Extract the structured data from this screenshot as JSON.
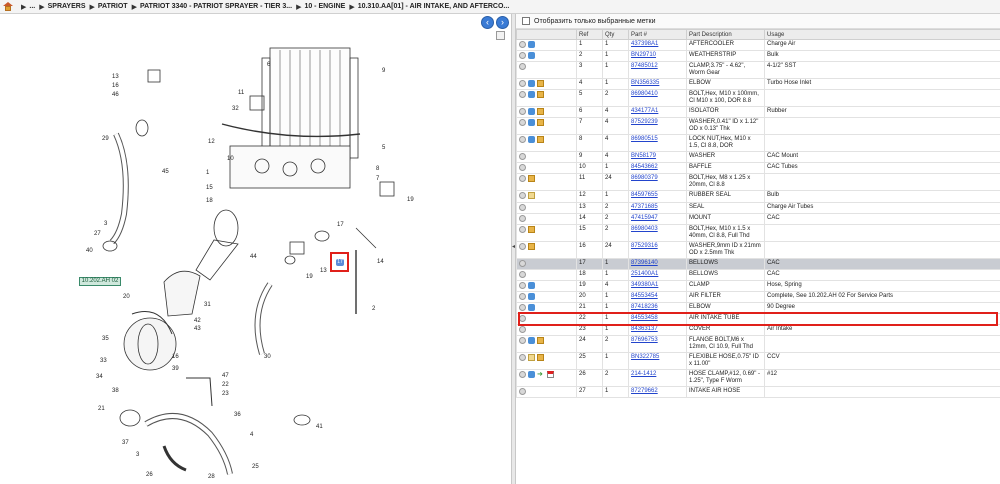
{
  "breadcrumb": {
    "items": [
      "...",
      "SPRAYERS",
      "PATRIOT",
      "PATRIOT 3340 - PATRIOT SPRAYER - TIER 3...",
      "10 - ENGINE",
      "10.310.AA[01] - AIR INTAKE, AND AFTERCO..."
    ]
  },
  "filter": {
    "label": "Отобразить только выбранные метки"
  },
  "table": {
    "headers": [
      "",
      "Ref",
      "Qty",
      "Part #",
      "Part Description",
      "Usage"
    ],
    "rows": [
      {
        "icons": [
          "circle",
          "hand"
        ],
        "ref": "1",
        "qty": "1",
        "part": "437398A1",
        "desc": "AFTERCOOLER",
        "usage": "Charge Air"
      },
      {
        "icons": [
          "circle",
          "hand"
        ],
        "ref": "2",
        "qty": "1",
        "part": "BN29710",
        "desc": "WEATHERSTRIP",
        "usage": "Bulk"
      },
      {
        "icons": [
          "circle"
        ],
        "ref": "3",
        "qty": "1",
        "part": "87485012",
        "desc": "CLAMP,3.75\" - 4.62\", Worm Gear",
        "usage": "4-1/2\" SST"
      },
      {
        "icons": [
          "circle",
          "hand",
          "box"
        ],
        "ref": "4",
        "qty": "1",
        "part": "BN356335",
        "desc": "ELBOW",
        "usage": "Turbo Hose Inlet"
      },
      {
        "icons": [
          "circle",
          "hand",
          "box"
        ],
        "ref": "5",
        "qty": "2",
        "part": "86980410",
        "desc": "BOLT,Hex, M10 x 100mm, Cl M10 x 100, DOR 8.8",
        "usage": ""
      },
      {
        "icons": [
          "circle",
          "hand",
          "box"
        ],
        "ref": "6",
        "qty": "4",
        "part": "434177A1",
        "desc": "ISOLATOR",
        "usage": "Rubber"
      },
      {
        "icons": [
          "circle",
          "hand",
          "box"
        ],
        "ref": "7",
        "qty": "4",
        "part": "87529239",
        "desc": "WASHER,0.41\" ID x 1.12\" OD x 0.13\" Thk",
        "usage": ""
      },
      {
        "icons": [
          "circle",
          "hand",
          "box"
        ],
        "ref": "8",
        "qty": "4",
        "part": "86980515",
        "desc": "LOCK NUT,Hex, M10 x 1.5, Cl 8.8, DOR",
        "usage": ""
      },
      {
        "icons": [
          "circle"
        ],
        "ref": "9",
        "qty": "4",
        "part": "BN58179",
        "desc": "WASHER",
        "usage": "CAC Mount"
      },
      {
        "icons": [
          "circle"
        ],
        "ref": "10",
        "qty": "1",
        "part": "84543662",
        "desc": "BAFFLE",
        "usage": "CAC Tubes"
      },
      {
        "icons": [
          "circle",
          "box"
        ],
        "ref": "11",
        "qty": "24",
        "part": "86980379",
        "desc": "BOLT,Hex, M8 x 1.25 x 20mm, Cl 8.8",
        "usage": ""
      },
      {
        "icons": [
          "circle",
          "note"
        ],
        "ref": "12",
        "qty": "1",
        "part": "84597655",
        "desc": "RUBBER SEAL",
        "usage": "Bulb"
      },
      {
        "icons": [
          "circle"
        ],
        "ref": "13",
        "qty": "2",
        "part": "47371685",
        "desc": "SEAL",
        "usage": "Charge Air Tubes"
      },
      {
        "icons": [
          "circle"
        ],
        "ref": "14",
        "qty": "2",
        "part": "47415947",
        "desc": "MOUNT",
        "usage": "CAC"
      },
      {
        "icons": [
          "circle",
          "box"
        ],
        "ref": "15",
        "qty": "2",
        "part": "86980403",
        "desc": "BOLT,Hex, M10 x 1.5 x 40mm, Cl 8.8, Full Thd",
        "usage": ""
      },
      {
        "icons": [
          "circle",
          "box"
        ],
        "ref": "16",
        "qty": "24",
        "part": "87529316",
        "desc": "WASHER,9mm ID x 21mm OD x 2.5mm Thk",
        "usage": ""
      },
      {
        "icons": [
          "circle"
        ],
        "ref": "17",
        "qty": "1",
        "part": "87396140",
        "desc": "BELLOWS",
        "usage": "CAC",
        "selected": true
      },
      {
        "icons": [
          "circle"
        ],
        "ref": "18",
        "qty": "1",
        "part": "251400A1",
        "desc": "BELLOWS",
        "usage": "CAC"
      },
      {
        "icons": [
          "circle",
          "hand"
        ],
        "ref": "19",
        "qty": "4",
        "part": "349380A1",
        "desc": "CLAMP",
        "usage": "Hose, Spring"
      },
      {
        "icons": [
          "circle",
          "hand"
        ],
        "ref": "20",
        "qty": "1",
        "part": "84553454",
        "desc": "AIR FILTER",
        "usage": "Complete, See 10.202.AH 02 For Service Parts"
      },
      {
        "icons": [
          "circle",
          "hand"
        ],
        "ref": "21",
        "qty": "1",
        "part": "87418236",
        "desc": "ELBOW",
        "usage": "90 Degree"
      },
      {
        "icons": [
          "circle"
        ],
        "ref": "22",
        "qty": "1",
        "part": "84553458",
        "desc": "AIR INTAKE TUBE",
        "usage": ""
      },
      {
        "icons": [
          "circle"
        ],
        "ref": "23",
        "qty": "1",
        "part": "84363137",
        "desc": "COVER",
        "usage": "Air Intake"
      },
      {
        "icons": [
          "circle",
          "hand",
          "box"
        ],
        "ref": "24",
        "qty": "2",
        "part": "87696753",
        "desc": "FLANGE BOLT,M6 x 12mm, Cl 10.9, Full Thd",
        "usage": ""
      },
      {
        "icons": [
          "circle",
          "note",
          "box"
        ],
        "ref": "25",
        "qty": "1",
        "part": "BN322785",
        "desc": "FLEXIBLE HOSE,0.75\" ID x 11.00\"",
        "usage": "CCV"
      },
      {
        "icons": [
          "circle",
          "hand",
          "arrow",
          "flag"
        ],
        "ref": "26",
        "qty": "2",
        "part": "214-1412",
        "desc": "HOSE CLAMP,#12, 0.69\" - 1.25\", Type F Worm",
        "usage": "#12"
      },
      {
        "icons": [
          "circle"
        ],
        "ref": "27",
        "qty": "1",
        "part": "87279662",
        "desc": "INTAKE AIR HOSE",
        "usage": ""
      }
    ]
  },
  "diagram": {
    "callout": "10.202.AH 02",
    "labels": [
      "13",
      "16",
      "46",
      "32",
      "11",
      "6",
      "9",
      "5",
      "8",
      "7",
      "29",
      "12",
      "10",
      "45",
      "15",
      "18",
      "1",
      "19",
      "27",
      "3",
      "40",
      "44",
      "17",
      "13",
      "19",
      "14",
      "2",
      "20",
      "31",
      "42",
      "43",
      "35",
      "33",
      "34",
      "16",
      "39",
      "38",
      "30",
      "47",
      "22",
      "23",
      "21",
      "37",
      "36",
      "41",
      "4",
      "3",
      "25",
      "28",
      "26"
    ]
  }
}
